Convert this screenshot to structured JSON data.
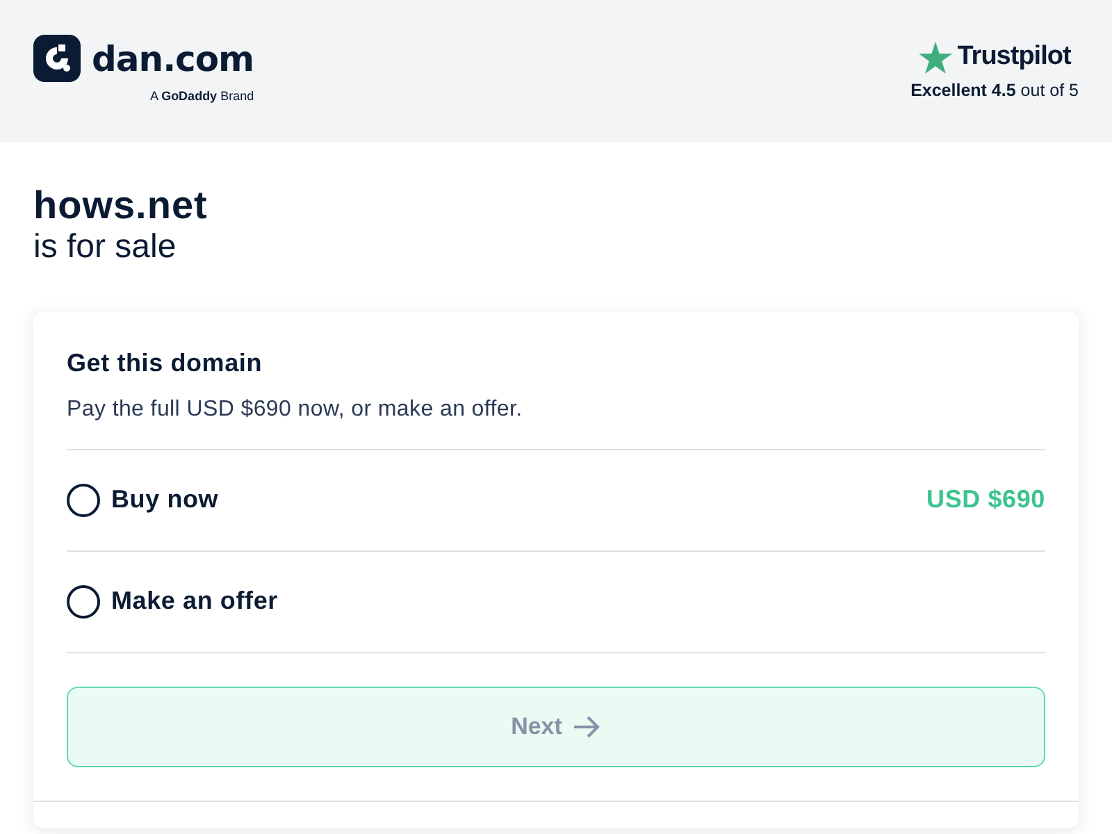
{
  "header": {
    "logo": {
      "name": "dan.com",
      "tagline": "A **GoDaddy** Brand"
    },
    "trustpilot": {
      "name": "Trustpilot",
      "rating": "**Excellent 4.5** out of 5"
    }
  },
  "domain": {
    "name": "hows.net",
    "subtitle": "is for sale"
  },
  "card": {
    "title": "Get this domain",
    "description": "Pay the full USD $690 now, or make an offer.",
    "options": [
      {
        "label": "Buy now",
        "price": "USD $690",
        "selected": false
      },
      {
        "label": "Make an offer",
        "selected": false
      }
    ],
    "next_button": {
      "label": "Next",
      "disabled": true
    }
  }
}
